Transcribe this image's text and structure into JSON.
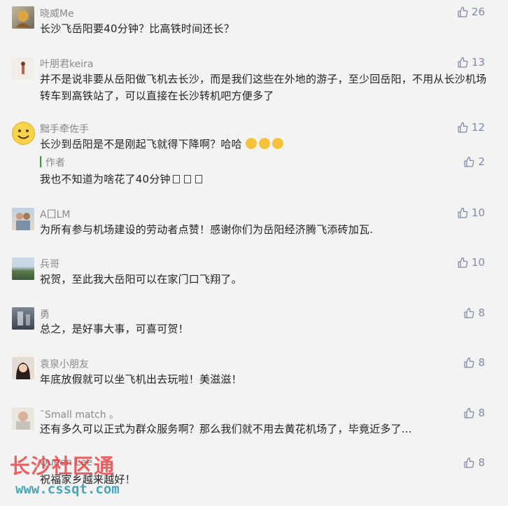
{
  "comments": [
    {
      "name": "晓威Me",
      "text": "长沙飞岳阳要40分钟？比高铁时间还长？",
      "likes": "26"
    },
    {
      "name": "叶朋君keira",
      "text": "并不是说非要从岳阳做飞机去长沙，而是我们这些在外地的游子，至少回岳阳，不用从长沙机场转车到高铁站了，可以直接在长沙转机吧方便多了",
      "likes": "13"
    },
    {
      "name": "黜手牵佐手",
      "text": "长沙到岳阳是不是刚起飞就得下降啊？哈哈",
      "likes": "12",
      "reply": {
        "label": "作者",
        "text": "我也不知道为啥花了40分钟",
        "likes": "2"
      }
    },
    {
      "name": "A囗LM",
      "text": "为所有参与机场建设的劳动者点赞！感谢你们为岳阳经济腾飞添砖加瓦.",
      "likes": "10"
    },
    {
      "name": "兵哥",
      "text": "祝贺，至此我大岳阳可以在家门口飞翔了。",
      "likes": "10"
    },
    {
      "name": "勇",
      "text": "总之，是好事大事，可喜可贺！",
      "likes": "8"
    },
    {
      "name": "袁泉小朋友",
      "text": "年底放假就可以坐飞机出去玩啦！美滋滋！",
      "likes": "8"
    },
    {
      "name": "ˉSmall match 。",
      "text": "还有多久可以正式为群众服务啊？那么我们就不用去黄花机场了，毕竟近多了...",
      "likes": "8"
    },
    {
      "name": "Queen Lee",
      "text": "祝福家乡越来越好！",
      "likes": "8"
    }
  ],
  "watermark": {
    "title": "长沙社区通",
    "url": "www.cssqt.com"
  },
  "colors": {
    "like": "#7f8aa8",
    "reply_bar": "#1aad19",
    "name": "#8a8a8a"
  }
}
